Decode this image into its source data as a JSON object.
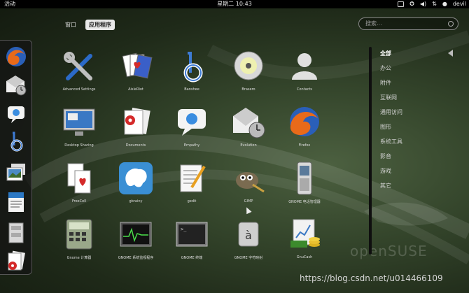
{
  "topbar": {
    "activities": "活动",
    "clock": "星期二 10:43",
    "user": "devil"
  },
  "view_tabs": [
    {
      "label": "窗口",
      "active": false
    },
    {
      "label": "应用程序",
      "active": true
    }
  ],
  "search": {
    "placeholder": "搜索..."
  },
  "dash": [
    {
      "name": "firefox-icon"
    },
    {
      "name": "evolution-icon"
    },
    {
      "name": "empathy-icon"
    },
    {
      "name": "banshee-icon"
    },
    {
      "name": "shotwell-icon"
    },
    {
      "name": "writer-icon"
    },
    {
      "name": "files-icon"
    },
    {
      "name": "documents-icon"
    }
  ],
  "apps": [
    {
      "label": "Advanced Settings",
      "icon": "tools-icon"
    },
    {
      "label": "AisleRiot",
      "icon": "cards-icon"
    },
    {
      "label": "Banshee",
      "icon": "banshee-icon"
    },
    {
      "label": "Brasero",
      "icon": "disc-icon"
    },
    {
      "label": "Contacts",
      "icon": "contacts-icon"
    },
    {
      "label": "Desktop Sharing",
      "icon": "monitor-icon"
    },
    {
      "label": "Documents",
      "icon": "documents-icon"
    },
    {
      "label": "Empathy",
      "icon": "chat-icon"
    },
    {
      "label": "Evolution",
      "icon": "mail-clock-icon"
    },
    {
      "label": "Firefox",
      "icon": "firefox-icon"
    },
    {
      "label": "FreeCell",
      "icon": "freecell-icon"
    },
    {
      "label": "gbrainy",
      "icon": "brain-icon"
    },
    {
      "label": "gedit",
      "icon": "text-editor-icon"
    },
    {
      "label": "GIMP",
      "icon": "gimp-icon"
    },
    {
      "label": "GNOME 电话管理器",
      "icon": "phone-icon"
    },
    {
      "label": "Gnome 计算器",
      "icon": "calculator-icon"
    },
    {
      "label": "GNOME 系统监视程序",
      "icon": "system-monitor-icon"
    },
    {
      "label": "GNOME 终端",
      "icon": "terminal-icon"
    },
    {
      "label": "GNOME 字符映射",
      "icon": "character-map-icon"
    },
    {
      "label": "GnuCash",
      "icon": "gnucash-icon"
    }
  ],
  "categories": [
    {
      "label": "全部",
      "active": true
    },
    {
      "label": "办公",
      "active": false
    },
    {
      "label": "附件",
      "active": false
    },
    {
      "label": "互联网",
      "active": false
    },
    {
      "label": "通用访问",
      "active": false
    },
    {
      "label": "图形",
      "active": false
    },
    {
      "label": "系统工具",
      "active": false
    },
    {
      "label": "影音",
      "active": false
    },
    {
      "label": "游戏",
      "active": false
    },
    {
      "label": "其它",
      "active": false
    }
  ],
  "branding": "openSUSE",
  "watermark": "https://blog.csdn.net/u014466109"
}
